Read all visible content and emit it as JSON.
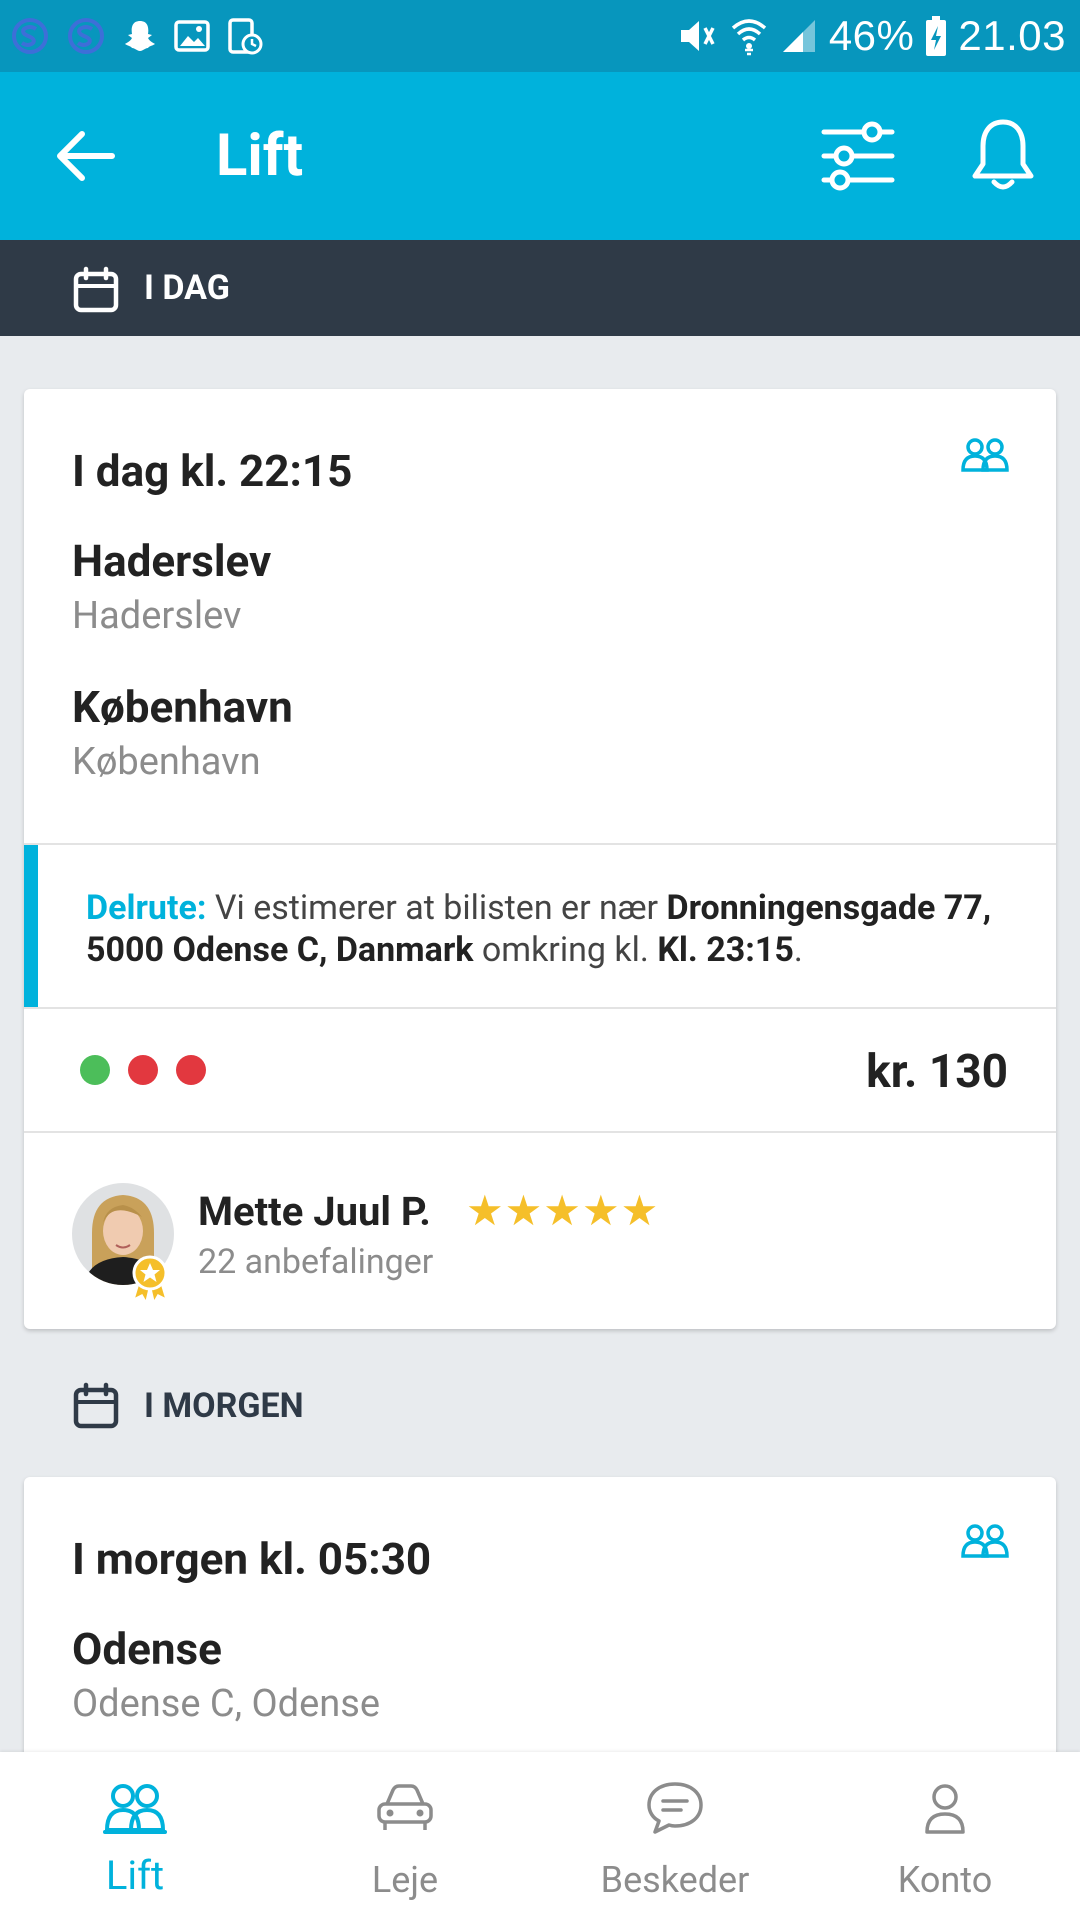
{
  "status_bar": {
    "battery": "46%",
    "time": "21.03",
    "icons": [
      "s-app-icon",
      "s-app-icon",
      "snapchat-icon",
      "gallery-icon",
      "usage-icon",
      "mute-vibrate-icon",
      "wifi-icon",
      "signal-icon",
      "battery-charging-icon"
    ]
  },
  "app_bar": {
    "title": "Lift",
    "icons": [
      "back-arrow-icon",
      "filter-sliders-icon",
      "bell-icon"
    ]
  },
  "sections": {
    "today": "I DAG",
    "tomorrow": "I MORGEN"
  },
  "rides": [
    {
      "time": "I dag kl. 22:15",
      "from_city": "Haderslev",
      "from_sub": "Haderslev",
      "to_city": "København",
      "to_sub": "København",
      "delrute": {
        "label": "Delrute:",
        "text1": " Vi estimerer at bilisten er nær ",
        "place": "Dronningensgade 77, 5000 Odense C, Danmark",
        "text2": " omkring kl. ",
        "time": "Kl. 23:15",
        "end": "."
      },
      "seat_dots": [
        "#4cbe5a",
        "#e2383f",
        "#e2383f"
      ],
      "price": "kr. 130",
      "driver": {
        "name": "Mette Juul P.",
        "stars": "★★★★★",
        "rating": 5,
        "recommendations": "22 anbefalinger"
      }
    },
    {
      "time": "I morgen kl. 05:30",
      "from_city": "Odense",
      "from_sub": "Odense C, Odense"
    }
  ],
  "bottom_nav": [
    {
      "label": "Lift",
      "icon": "people-icon",
      "active": true
    },
    {
      "label": "Leje",
      "icon": "car-icon",
      "active": false
    },
    {
      "label": "Beskeder",
      "icon": "chat-icon",
      "active": false
    },
    {
      "label": "Konto",
      "icon": "person-icon",
      "active": false
    }
  ],
  "colors": {
    "accent": "#00b2dc",
    "status_bar": "#0796bd",
    "section_dark": "#2f3a47",
    "star": "#f5bf2a",
    "background": "#e8ebee"
  }
}
